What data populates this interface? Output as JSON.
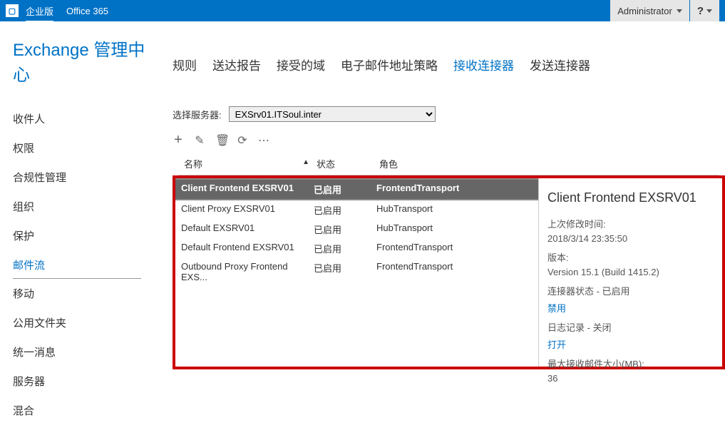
{
  "topbar": {
    "enterprise": "企业版",
    "product": "Office 365",
    "admin": "Administrator",
    "help": "?"
  },
  "page_title": "Exchange 管理中心",
  "sidebar": {
    "items": [
      {
        "label": "收件人"
      },
      {
        "label": "权限"
      },
      {
        "label": "合规性管理"
      },
      {
        "label": "组织"
      },
      {
        "label": "保护"
      },
      {
        "label": "邮件流"
      },
      {
        "label": "移动"
      },
      {
        "label": "公用文件夹"
      },
      {
        "label": "统一消息"
      },
      {
        "label": "服务器"
      },
      {
        "label": "混合"
      }
    ],
    "active_index": 5
  },
  "tabs": {
    "items": [
      "规则",
      "送达报告",
      "接受的域",
      "电子邮件地址策略",
      "接收连接器",
      "发送连接器"
    ],
    "active_index": 4
  },
  "server_select": {
    "label": "选择服务器:",
    "value": "EXSrv01.ITSoul.inter"
  },
  "toolbar": {
    "add": "+",
    "edit": "✎",
    "delete": "🗑",
    "refresh": "⟳",
    "more": "⋯"
  },
  "grid": {
    "headers": {
      "name": "名称",
      "status": "状态",
      "role": "角色"
    },
    "rows": [
      {
        "name": "Client Frontend EXSRV01",
        "status": "已启用",
        "role": "FrontendTransport"
      },
      {
        "name": "Client Proxy EXSRV01",
        "status": "已启用",
        "role": "HubTransport"
      },
      {
        "name": "Default EXSRV01",
        "status": "已启用",
        "role": "HubTransport"
      },
      {
        "name": "Default Frontend EXSRV01",
        "status": "已启用",
        "role": "FrontendTransport"
      },
      {
        "name": "Outbound Proxy Frontend EXS...",
        "status": "已启用",
        "role": "FrontendTransport"
      }
    ],
    "selected_index": 0
  },
  "details": {
    "title": "Client Frontend EXSRV01",
    "last_modified_label": "上次修改时间:",
    "last_modified": "2018/3/14 23:35:50",
    "version_label": "版本:",
    "version": "Version 15.1 (Build 1415.2)",
    "connector_status": "连接器状态 - 已启用",
    "disable_link": "禁用",
    "logging": "日志记录 - 关闭",
    "open_link": "打开",
    "max_size_label": "最大接收邮件大小(MB):",
    "max_size": "36"
  }
}
